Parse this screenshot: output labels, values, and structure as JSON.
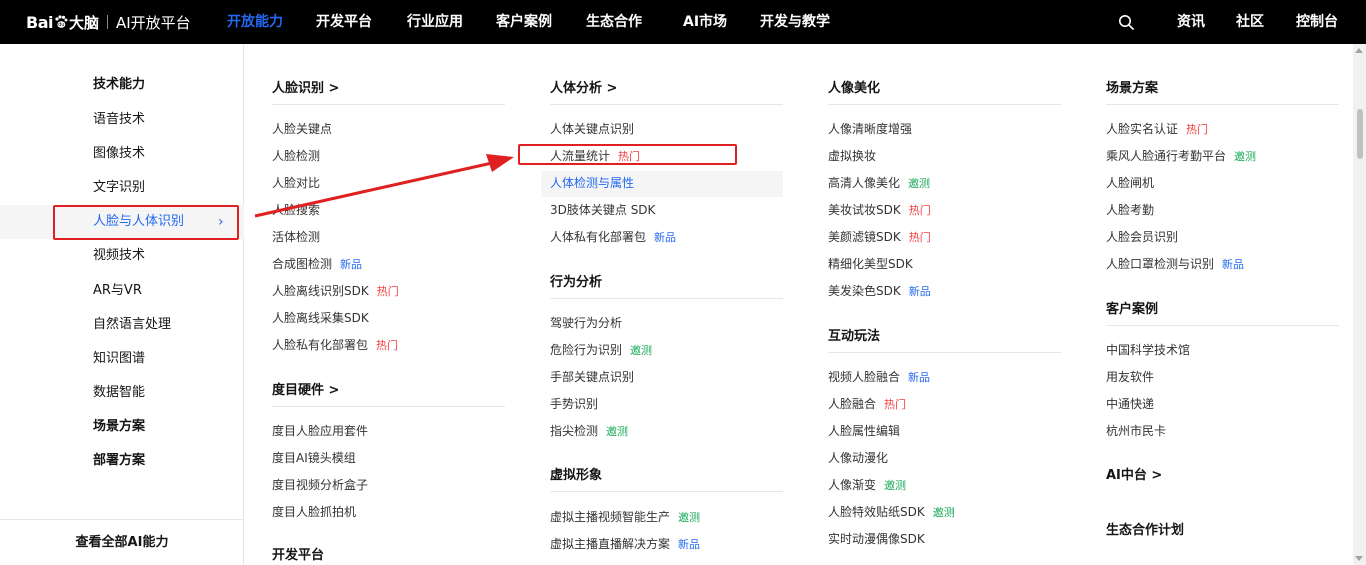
{
  "header": {
    "logo_bai": "Bai",
    "logo_du": "大脑",
    "logo_platform": "AI开放平台",
    "nav": [
      "开放能力",
      "开发平台",
      "行业应用",
      "客户案例",
      "生态合作",
      "AI市场",
      "开发与教学"
    ],
    "active_nav": "开放能力",
    "right": [
      "资讯",
      "社区",
      "控制台"
    ],
    "search_icon": "search-icon"
  },
  "sidebar": {
    "items": [
      "技术能力",
      "语音技术",
      "图像技术",
      "文字识别",
      "人脸与人体识别",
      "视频技术",
      "AR与VR",
      "自然语言处理",
      "知识图谱",
      "数据智能",
      "场景方案",
      "部署方案"
    ],
    "active": "人脸与人体识别",
    "chevron": "›",
    "footer": "查看全部AI能力"
  },
  "columns": {
    "c1": {
      "face_title": "人脸识别 >",
      "face_items": [
        {
          "label": "人脸关键点",
          "badge": ""
        },
        {
          "label": "人脸检测",
          "badge": ""
        },
        {
          "label": "人脸对比",
          "badge": ""
        },
        {
          "label": "人脸搜索",
          "badge": ""
        },
        {
          "label": "活体检测",
          "badge": ""
        },
        {
          "label": "合成图检测",
          "badge": "新品"
        },
        {
          "label": "人脸离线识别SDK",
          "badge": "热门"
        },
        {
          "label": "人脸离线采集SDK",
          "badge": ""
        },
        {
          "label": "人脸私有化部署包",
          "badge": "热门"
        }
      ],
      "hw_title": "度目硬件 >",
      "hw_items": [
        {
          "label": "度目人脸应用套件",
          "badge": ""
        },
        {
          "label": "度目AI镜头模组",
          "badge": ""
        },
        {
          "label": "度目视频分析盒子",
          "badge": ""
        },
        {
          "label": "度目人脸抓拍机",
          "badge": ""
        }
      ],
      "dev_title": "开发平台"
    },
    "c2": {
      "body_title": "人体分析 >",
      "body_items": [
        {
          "label": "人体关键点识别",
          "badge": ""
        },
        {
          "label": "人流量统计",
          "badge": "热门"
        },
        {
          "label": "人体检测与属性",
          "badge": ""
        },
        {
          "label": "3D肢体关键点 SDK",
          "badge": ""
        },
        {
          "label": "人体私有化部署包",
          "badge": "新品"
        }
      ],
      "behavior_title": "行为分析",
      "behavior_items": [
        {
          "label": "驾驶行为分析",
          "badge": ""
        },
        {
          "label": "危险行为识别",
          "badge": "邀测"
        },
        {
          "label": "手部关键点识别",
          "badge": ""
        },
        {
          "label": "手势识别",
          "badge": ""
        },
        {
          "label": "指尖检测",
          "badge": "邀测"
        }
      ],
      "virtual_title": "虚拟形象",
      "virtual_items": [
        {
          "label": "虚拟主播视频智能生产",
          "badge": "邀测"
        },
        {
          "label": "虚拟主播直播解决方案",
          "badge": "新品"
        }
      ]
    },
    "c3": {
      "beauty_title": "人像美化",
      "beauty_items": [
        {
          "label": "人像清晰度增强",
          "badge": ""
        },
        {
          "label": "虚拟换妆",
          "badge": ""
        },
        {
          "label": "高清人像美化",
          "badge": "邀测"
        },
        {
          "label": "美妆试妆SDK",
          "badge": "热门"
        },
        {
          "label": "美颜滤镜SDK",
          "badge": "热门"
        },
        {
          "label": "精细化美型SDK",
          "badge": ""
        },
        {
          "label": "美发染色SDK",
          "badge": "新品"
        }
      ],
      "interact_title": "互动玩法",
      "interact_items": [
        {
          "label": "视频人脸融合",
          "badge": "新品"
        },
        {
          "label": "人脸融合",
          "badge": "热门"
        },
        {
          "label": "人脸属性编辑",
          "badge": ""
        },
        {
          "label": "人像动漫化",
          "badge": ""
        },
        {
          "label": "人像渐变",
          "badge": "邀测"
        },
        {
          "label": "人脸特效贴纸SDK",
          "badge": "邀测"
        },
        {
          "label": "实时动漫偶像SDK",
          "badge": ""
        }
      ]
    },
    "c4": {
      "scene_title": "场景方案",
      "scene_items": [
        {
          "label": "人脸实名认证",
          "badge": "热门"
        },
        {
          "label": "乘风人脸通行考勤平台",
          "badge": "邀测"
        },
        {
          "label": "人脸闸机",
          "badge": ""
        },
        {
          "label": "人脸考勤",
          "badge": ""
        },
        {
          "label": "人脸会员识别",
          "badge": ""
        },
        {
          "label": "人脸口罩检测与识别",
          "badge": "新品"
        }
      ],
      "case_title": "客户案例",
      "case_items": [
        {
          "label": "中国科学技术馆",
          "badge": ""
        },
        {
          "label": "用友软件",
          "badge": ""
        },
        {
          "label": "中通快递",
          "badge": ""
        },
        {
          "label": "杭州市民卡",
          "badge": ""
        }
      ],
      "ai_title": "AI中台 >",
      "eco_title": "生态合作计划"
    }
  },
  "colors": {
    "accent": "#2468f2",
    "hot": "#f33e3e",
    "beta": "#18a957",
    "annotation": "#e02020"
  }
}
